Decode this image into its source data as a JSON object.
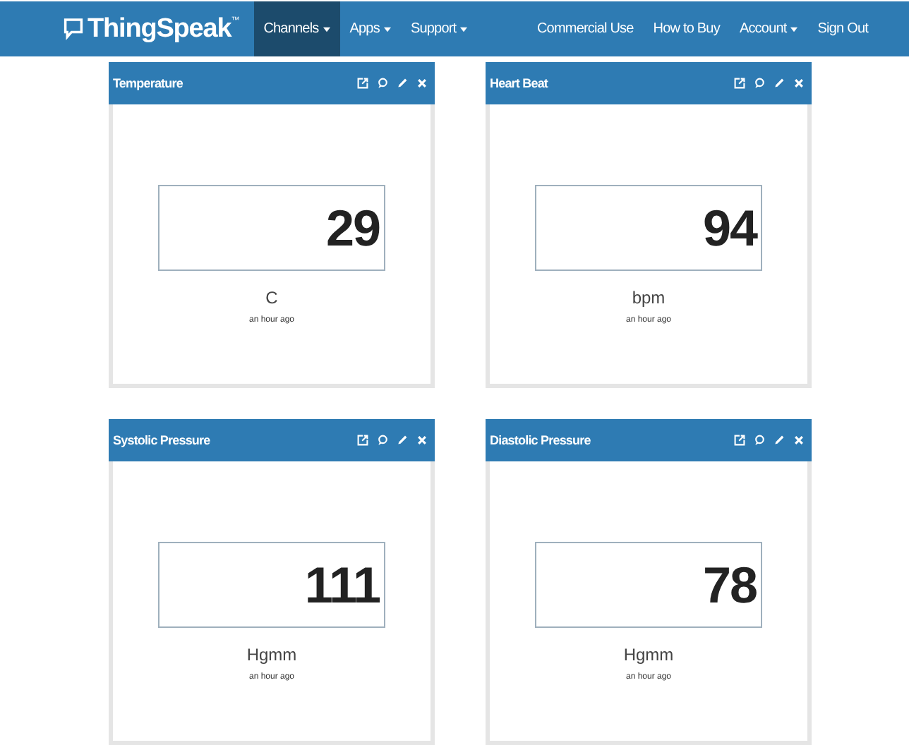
{
  "navbar": {
    "brand": "ThingSpeak",
    "trademark": "™",
    "left_items": [
      {
        "label": "Channels",
        "dropdown": true,
        "selected": true
      },
      {
        "label": "Apps",
        "dropdown": true,
        "selected": false
      },
      {
        "label": "Support",
        "dropdown": true,
        "selected": false
      }
    ],
    "right_items": [
      {
        "label": "Commercial Use",
        "dropdown": false
      },
      {
        "label": "How to Buy",
        "dropdown": false
      },
      {
        "label": "Account",
        "dropdown": true
      },
      {
        "label": "Sign Out",
        "dropdown": false
      }
    ]
  },
  "widgets": [
    {
      "title": "Temperature",
      "value": "29",
      "unit": "C",
      "updated": "an hour ago"
    },
    {
      "title": "Heart Beat",
      "value": "94",
      "unit": "bpm",
      "updated": "an hour ago"
    },
    {
      "title": "Systolic Pressure",
      "value": "111",
      "unit": "Hgmm",
      "updated": "an hour ago"
    },
    {
      "title": "Diastolic Pressure",
      "value": "78",
      "unit": "Hgmm",
      "updated": "an hour ago"
    }
  ]
}
